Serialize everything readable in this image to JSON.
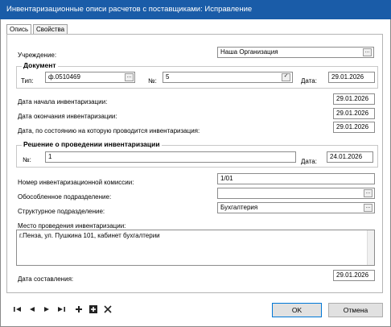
{
  "window": {
    "title": "Инвентаризационные описи расчетов с поставщиками: Исправление"
  },
  "tabs": [
    {
      "label": "Опись",
      "active": true
    },
    {
      "label": "Свойства",
      "active": false
    }
  ],
  "form": {
    "institution": {
      "label": "Учреждение:",
      "value": "Наша Организация"
    },
    "document": {
      "group_title": "Документ",
      "type_label": "Тип:",
      "type_value": "ф.0510469",
      "number_label": "№:",
      "number_value": "5",
      "date_label": "Дата:",
      "date_value": "29.01.2026"
    },
    "start_date": {
      "label": "Дата начала инвентаризации:",
      "value": "29.01.2026"
    },
    "end_date": {
      "label": "Дата окончания инвентаризации:",
      "value": "29.01.2026"
    },
    "as_of_date": {
      "label": "Дата, по состоянию на которую проводится инвентаризация:",
      "value": "29.01.2026"
    },
    "decision": {
      "group_title": "Решение о проведении инвентаризации",
      "number_label": "№:",
      "number_value": "1",
      "date_label": "Дата:",
      "date_value": "24.01.2026"
    },
    "commission": {
      "label": "Номер инвентаризационной комиссии:",
      "value": "1/01"
    },
    "separate_division": {
      "label": "Обособленное подразделение:",
      "value": ""
    },
    "structural_division": {
      "label": "Структурное подразделение:",
      "value": "Бухгалтерия"
    },
    "place": {
      "label": "Место проведения инвентаризации:",
      "value": "г.Пенза, ул. Пушкина 101, кабинет бухгалтерии"
    },
    "compile_date": {
      "label": "Дата составления:",
      "value": "29.01.2026"
    }
  },
  "buttons": {
    "ok": "OK",
    "cancel": "Отмена",
    "ellipsis": "..."
  },
  "nav_icons": [
    "first-record-icon",
    "prev-record-icon",
    "next-record-icon",
    "last-record-icon",
    "add-icon",
    "add-copy-icon",
    "delete-icon"
  ],
  "colors": {
    "titlebar": "#1a5ca8",
    "accent": "#0078d7"
  }
}
